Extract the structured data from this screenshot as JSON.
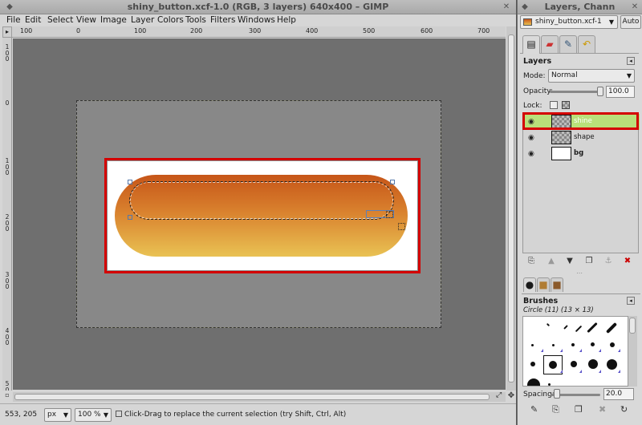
{
  "main_window": {
    "title": "shiny_button.xcf-1.0 (RGB, 3 layers) 640x400 – GIMP",
    "menu": [
      "File",
      "Edit",
      "Select",
      "View",
      "Image",
      "Layer",
      "Colors",
      "Tools",
      "Filters",
      "Windows",
      "Help"
    ],
    "ruler_h_labels": [
      "100",
      "0",
      "100",
      "200",
      "300",
      "400",
      "500",
      "600",
      "700"
    ],
    "ruler_v_labels": [
      "1\n0\n0",
      "0",
      "1\n0\n0",
      "2\n0\n0",
      "3\n0\n0",
      "4\n0\n0",
      "5\n0\n0"
    ],
    "status": {
      "coords": "553, 205",
      "unit": "px",
      "zoom": "100 %",
      "message": "Click-Drag to replace the current selection (try Shift, Ctrl, Alt)"
    }
  },
  "dock": {
    "title": "Layers, Chann",
    "image_combo": "shiny_button.xcf-1",
    "auto_label": "Auto",
    "layers_title": "Layers",
    "mode_label": "Mode:",
    "mode_value": "Normal",
    "opacity_label": "Opacity:",
    "opacity_value": "100.0",
    "lock_label": "Lock:",
    "layers": [
      {
        "name": "shine",
        "selected": true
      },
      {
        "name": "shape",
        "selected": false
      },
      {
        "name": "bg",
        "selected": false
      }
    ],
    "brushes_title": "Brushes",
    "brush_name": "Circle (11) (13 × 13)",
    "spacing_label": "Spacing:",
    "spacing_value": "20.0"
  },
  "colors": {
    "highlight": "#d40000",
    "selected_layer": "#b9e07a",
    "button_top": "#c65518",
    "button_bottom": "#e9c253"
  }
}
